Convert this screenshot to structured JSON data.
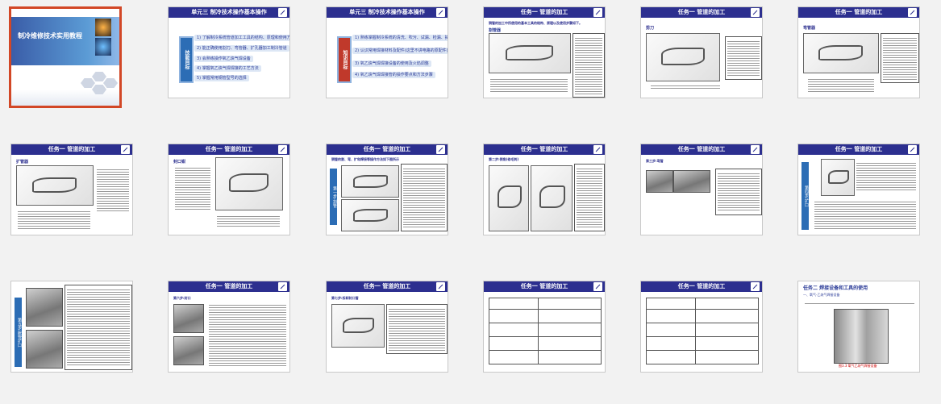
{
  "slides": {
    "s1": {
      "title": "制冷维修技术实用教程"
    },
    "s2": {
      "header": "单元三 制冷技术操作基本操作",
      "badge": "技能目标",
      "items": [
        "1) 了解制冷系统管道加工工具的结构、原理和使用方法",
        "2) 能正确使用割刀、弯管器、扩孔器加工制冷管道",
        "3) 会熟练操作氧乙炔气焊设备",
        "4) 掌握氧乙炔气焊焊接的工艺方法",
        "5) 掌握常用钢管型号的选择"
      ]
    },
    "s3": {
      "header": "单元三 制冷技术操作基本操作",
      "badge": "知识目标",
      "items": [
        "1) 熟练掌握制冷系统的清洗、吹污、试漏、检漏、抽真空、充灌制冷剂的方法,工艺要点",
        "2) 认识常用焊接材料及配件(这里不讲电路的原配件),熟悉各种管路",
        "3) 氧乙炔气焊焊接设备的使用及火焰调整",
        "4) 氧乙炔气焊焊接管的操作要点和方法步骤"
      ]
    },
    "s4": {
      "header": "任务一 管道的加工",
      "sub": "铜管的加工中所使用的基本工具的结构、原理以及使用步骤如下。",
      "label": "割管器"
    },
    "s5": {
      "header": "任务一 管道的加工",
      "label": "剪刀"
    },
    "s6": {
      "header": "任务一 管道的加工",
      "label": "弯管器"
    },
    "s7": {
      "header": "任务一 管道的加工",
      "label": "扩管器"
    },
    "s8": {
      "header": "任务一 管道的加工",
      "label": "封口钳"
    },
    "s9": {
      "header": "任务一 管道的加工",
      "sub": "铜管的割、弯、扩和焊接等操作方法如下图所示",
      "side": "第一步:割管"
    },
    "s10": {
      "header": "任务一 管道的加工",
      "label": "第二步:倒角(修毛刺)"
    },
    "s11": {
      "header": "任务一 管道的加工",
      "label": "第三步:弯管"
    },
    "s12": {
      "header": "任务一 管道的加工",
      "side": "第四步:扩口"
    },
    "s13": {
      "header": "任务一 管道的加工",
      "side": "第五步:胀管扩口"
    },
    "s14": {
      "header": "任务一 管道的加工",
      "label": "第六步:封口"
    },
    "s15": {
      "header": "任务一 管道的加工",
      "label": "第七步:拆卸封口管"
    },
    "s16": {
      "header": "任务一 管道的加工"
    },
    "s17": {
      "header": "任务一 管道的加工"
    },
    "s18": {
      "title": "任务二 焊接设备和工具的使用",
      "sub": "一、氧气-乙炔气焊接设备",
      "caption": "图3.3 氧气乙炔气焊接设备"
    }
  }
}
